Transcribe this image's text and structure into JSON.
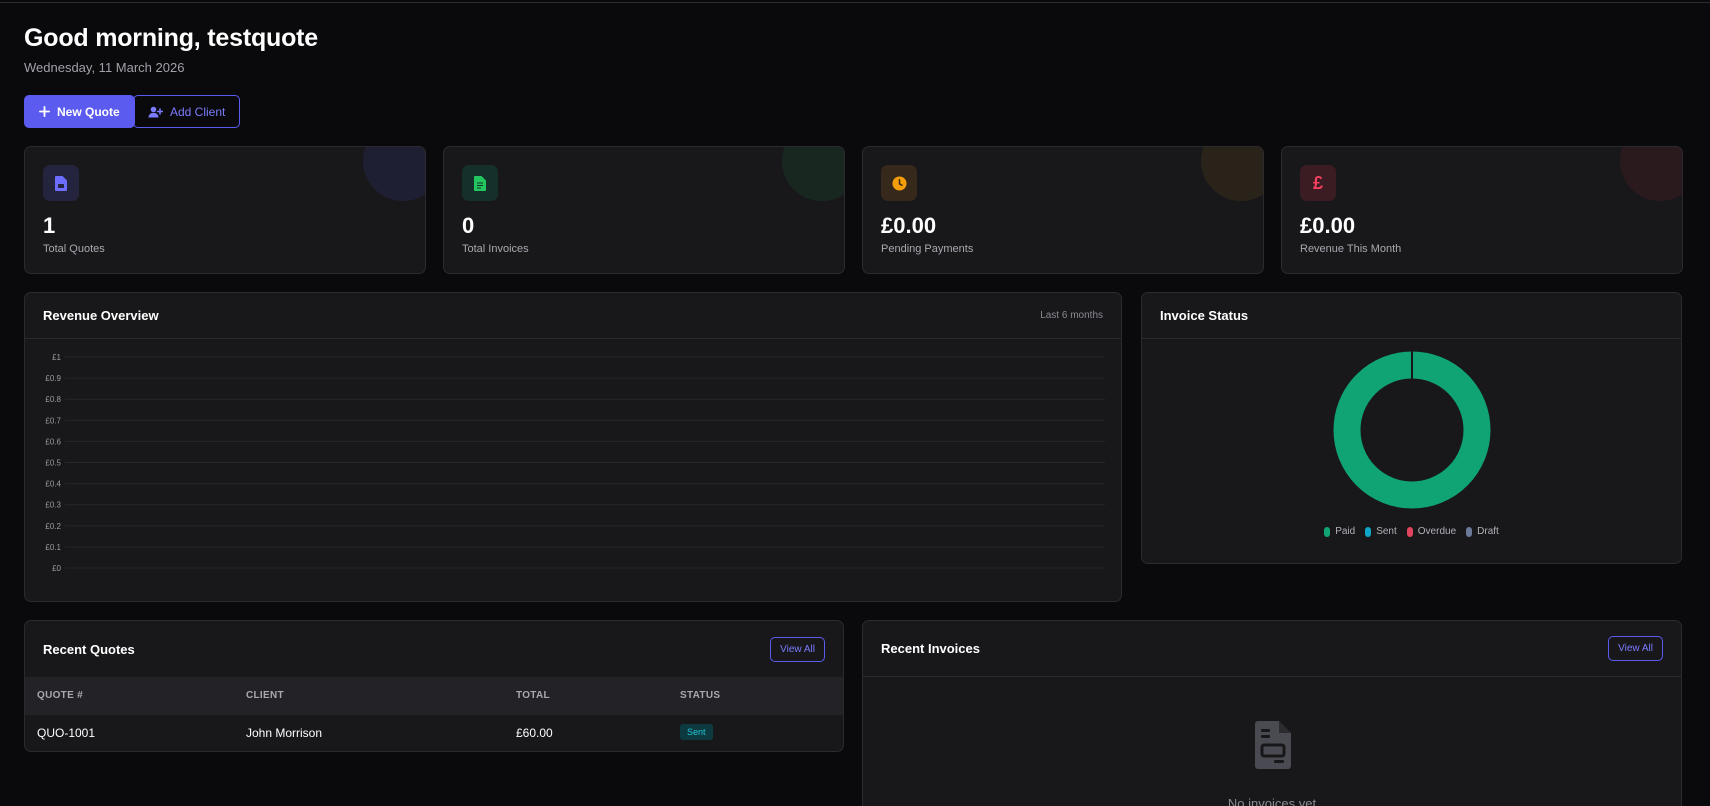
{
  "header": {
    "greeting": "Good morning, testquote",
    "date": "Wednesday, 11 March 2026"
  },
  "actions": {
    "new_quote": "New Quote",
    "add_client": "Add Client"
  },
  "stats": [
    {
      "value": "1",
      "label": "Total Quotes",
      "icon": "file-icon",
      "color": "#6d6dff",
      "bg": "#24243f"
    },
    {
      "value": "0",
      "label": "Total Invoices",
      "icon": "invoice-icon",
      "color": "#22c55e",
      "bg": "#15302a"
    },
    {
      "value": "£0.00",
      "label": "Pending Payments",
      "icon": "clock-icon",
      "color": "#f59e0b",
      "bg": "#36281a"
    },
    {
      "value": "£0.00",
      "label": "Revenue This Month",
      "icon": "pound-icon",
      "color": "#f43f5e",
      "bg": "#3a1c22"
    }
  ],
  "revenue": {
    "title": "Revenue Overview",
    "range": "Last 6 months"
  },
  "invoice_status": {
    "title": "Invoice Status"
  },
  "chart_data": [
    {
      "type": "line",
      "title": "Revenue Overview",
      "x": [],
      "series": [],
      "yticks": [
        "£1",
        "£0.9",
        "£0.8",
        "£0.7",
        "£0.6",
        "£0.5",
        "£0.4",
        "£0.3",
        "£0.2",
        "£0.1",
        "£0"
      ],
      "ylim": [
        0,
        1
      ],
      "grid": true
    },
    {
      "type": "pie",
      "title": "Invoice Status",
      "labels": [
        "Paid",
        "Sent",
        "Overdue",
        "Draft"
      ],
      "values": [
        1,
        0,
        0,
        0
      ],
      "colors": [
        "#10a374",
        "#0ea5c6",
        "#e0445e",
        "#6b7a99"
      ],
      "legend": "bottom"
    }
  ],
  "recent_quotes": {
    "title": "Recent Quotes",
    "view_all": "View All",
    "columns": [
      "QUOTE #",
      "CLIENT",
      "TOTAL",
      "STATUS"
    ],
    "rows": [
      {
        "number": "QUO-1001",
        "client": "John Morrison",
        "total": "£60.00",
        "status": "Sent"
      }
    ]
  },
  "recent_invoices": {
    "title": "Recent Invoices",
    "view_all": "View All",
    "empty": "No invoices yet"
  },
  "colors": {
    "accent": "#5b5bf0",
    "background": "#0a0a0c",
    "card": "#18181b"
  }
}
